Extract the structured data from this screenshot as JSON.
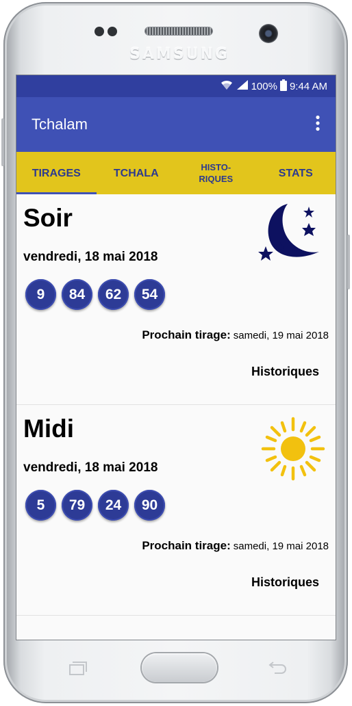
{
  "device": {
    "brand": "SAMSUNG"
  },
  "statusbar": {
    "battery": "100%",
    "time": "9:44 AM"
  },
  "appbar": {
    "title": "Tchalam",
    "menu_icon": "more-vert-icon"
  },
  "tabs": [
    {
      "label": "TIRAGES",
      "active": true
    },
    {
      "label": "TCHALA",
      "active": false
    },
    {
      "label": "HISTO-\nRIQUES",
      "active": false
    },
    {
      "label": "STATS",
      "active": false
    }
  ],
  "draws": [
    {
      "title": "Soir",
      "date": "vendredi, 18 mai 2018",
      "numbers": [
        "9",
        "84",
        "62",
        "54"
      ],
      "next_label": "Prochain tirage:",
      "next_date": "samedi, 19 mai 2018",
      "history_label": "Historiques",
      "icon": "moon-stars-icon"
    },
    {
      "title": "Midi",
      "date": "vendredi, 18 mai 2018",
      "numbers": [
        "5",
        "79",
        "24",
        "90"
      ],
      "next_label": "Prochain tirage:",
      "next_date": "samedi, 19 mai 2018",
      "history_label": "Historiques",
      "icon": "sun-icon"
    }
  ],
  "colors": {
    "primary": "#3f51b5",
    "primary_dark": "#303f9f",
    "tab_bar": "#e2c51c",
    "ball": "#2d3b96",
    "sun": "#f2c10f",
    "moon": "#0d1160"
  }
}
